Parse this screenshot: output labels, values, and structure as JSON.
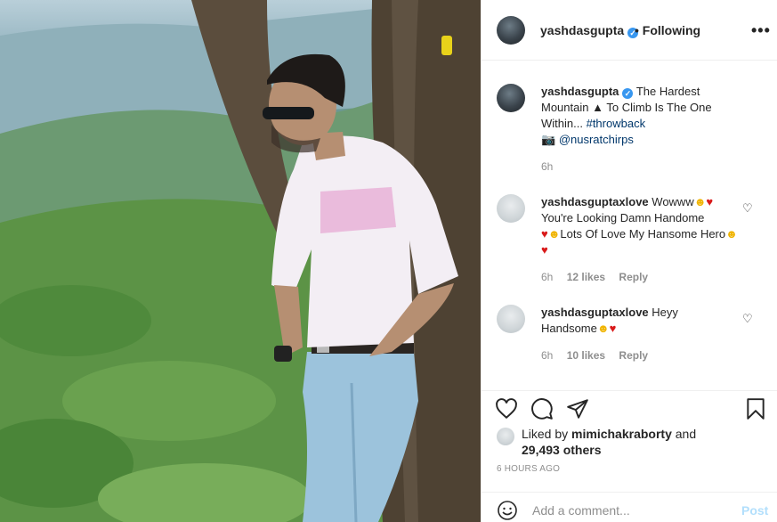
{
  "post": {
    "username": "yashdasgupta",
    "follow_status": "• Following",
    "more_label": "•••"
  },
  "caption": {
    "username": "yashdasgupta",
    "text": "The Hardest Mountain",
    "text2": "To Climb Is The One Within...",
    "hashtag": "#throwback",
    "camera": "📷",
    "mention": "@nusratchirps",
    "time": "6h"
  },
  "comments": [
    {
      "username": "yashdasguptaxlove",
      "text_a": "Wowww",
      "text_b": "You're Looking Damn Handome",
      "text_c": "Lots Of Love My Hansome",
      "text_d": "Hero",
      "time": "6h",
      "likes": "12 likes",
      "reply": "Reply"
    },
    {
      "username": "yashdasguptaxlove",
      "text_a": "Heyy",
      "text_b": "Handsome",
      "time": "6h",
      "likes": "10 likes",
      "reply": "Reply"
    }
  ],
  "likes": {
    "prefix": "Liked by",
    "user": "mimichakraborty",
    "and": "and",
    "others": "29,493 others"
  },
  "timestamp": "6 HOURS AGO",
  "comment_box": {
    "placeholder": "Add a comment...",
    "post_label": "Post"
  },
  "icons": {
    "verified": "verified-badge-icon",
    "like": "heart-icon",
    "comment": "comment-bubble-icon",
    "share": "paper-plane-icon",
    "save": "bookmark-icon",
    "emoji": "smiley-icon"
  },
  "colors": {
    "verified": "#3897f0",
    "link": "#00376b",
    "muted": "#8e8e8e",
    "post_disabled": "#b2dffc"
  }
}
